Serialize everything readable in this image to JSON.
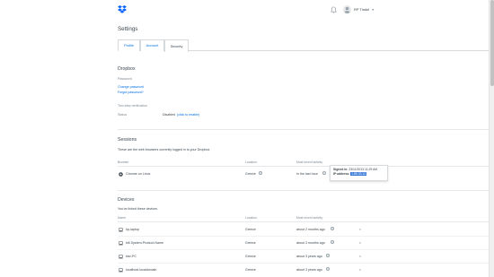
{
  "header": {
    "logo_icon": "dropbox-logo-icon",
    "notifications_icon": "bell-icon",
    "user_name": "RP Tindel"
  },
  "page": {
    "title": "Settings"
  },
  "tabs": [
    {
      "label": "Profile"
    },
    {
      "label": "Account"
    },
    {
      "label": "Security"
    }
  ],
  "dropbox": {
    "title": "Dropbox",
    "password_label": "Password",
    "change_password": "Change password",
    "forgot_password": "Forgot password?",
    "two_step_label": "Two-step verification",
    "status_label": "Status",
    "status_value": "Disabled",
    "enable_link": "(click to enable)"
  },
  "sessions": {
    "title": "Sessions",
    "description": "These are the web browsers currently logged in to your Dropbox.",
    "columns": {
      "browser": "Browser",
      "location": "Location",
      "activity": "Most recent activity"
    },
    "rows": [
      {
        "browser": "Chrome on Linux",
        "location": "Greece",
        "activity": "In the last hour"
      }
    ],
    "tooltip": {
      "signed_in_label": "Signed in:",
      "signed_in_value": "23/11/2013 11:29 AM",
      "ip_label": "IP address:",
      "ip_value": "1.85.33.12"
    }
  },
  "devices": {
    "title": "Devices",
    "description": "You've linked these devices.",
    "columns": {
      "name": "Name",
      "location": "Location",
      "activity": "Most recent activity"
    },
    "rows": [
      {
        "name": "hp-laptop",
        "location": "Greece",
        "activity": "about 2 months ago"
      },
      {
        "name": "bill-System-Product-Name",
        "location": "Greece",
        "activity": "about 3 months ago"
      },
      {
        "name": "bisr-PC",
        "location": "Greece",
        "activity": "about 3 years ago"
      },
      {
        "name": "localhost.localdomain",
        "location": "Greece",
        "activity": "about 3 years ago"
      }
    ],
    "remove_label": "x"
  }
}
